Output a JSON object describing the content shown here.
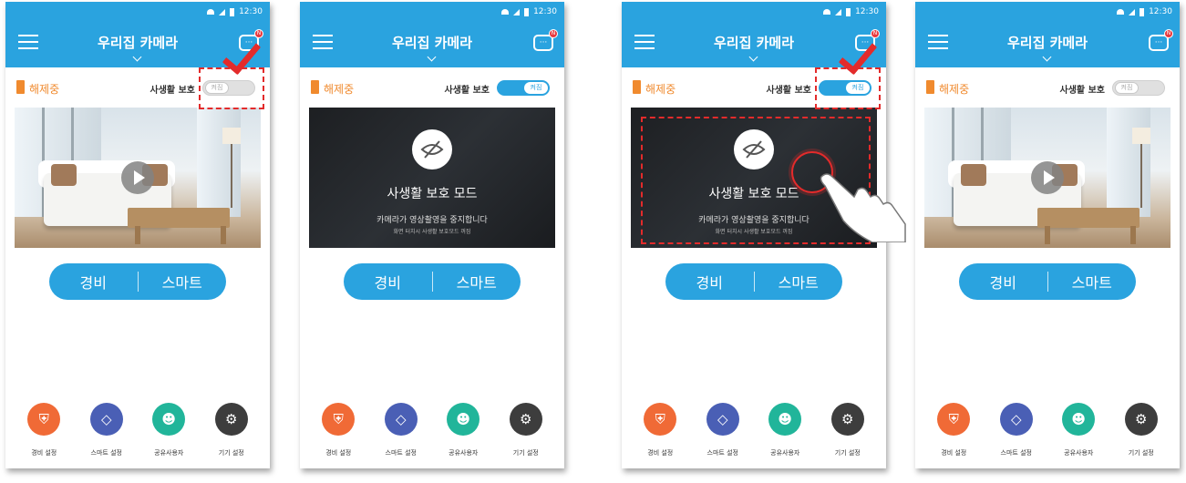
{
  "status_bar": {
    "time": "12:30"
  },
  "app_bar": {
    "title": "우리집 카메라",
    "chat_badge": "N"
  },
  "status_row": {
    "disarmed_label": "해제중",
    "privacy_label": "사생활 보호"
  },
  "toggle": {
    "on_text": "켜짐"
  },
  "privacy_overlay": {
    "title": "사생활 보호 모드",
    "description": "카메라가 영상촬영을 중지합니다",
    "note": "화면 터치시 사생활 보호모드 꺼짐"
  },
  "mode_button": {
    "guard": "경비",
    "smart": "스마트"
  },
  "bottom_nav": [
    {
      "label": "경비 설정",
      "icon": "shield-icon",
      "color": "#f06a36"
    },
    {
      "label": "스마트 설정",
      "icon": "smart-icon",
      "color": "#4a5fb5"
    },
    {
      "label": "공유사용자",
      "icon": "users-icon",
      "color": "#21b59a"
    },
    {
      "label": "기기 설정",
      "icon": "gear-icon",
      "color": "#3d3d3d"
    }
  ],
  "screens": [
    {
      "privacy": "off",
      "annotations": [
        "toggle-highlight",
        "checkmark"
      ]
    },
    {
      "privacy": "on",
      "annotations": []
    },
    {
      "privacy": "on",
      "annotations": [
        "toggle-highlight",
        "checkmark",
        "view-highlight",
        "tap-gesture"
      ]
    },
    {
      "privacy": "off",
      "annotations": []
    }
  ],
  "colors": {
    "brand_blue": "#2aa3df",
    "status_orange": "#f08a2e",
    "annotation_red": "#e32b2b"
  }
}
